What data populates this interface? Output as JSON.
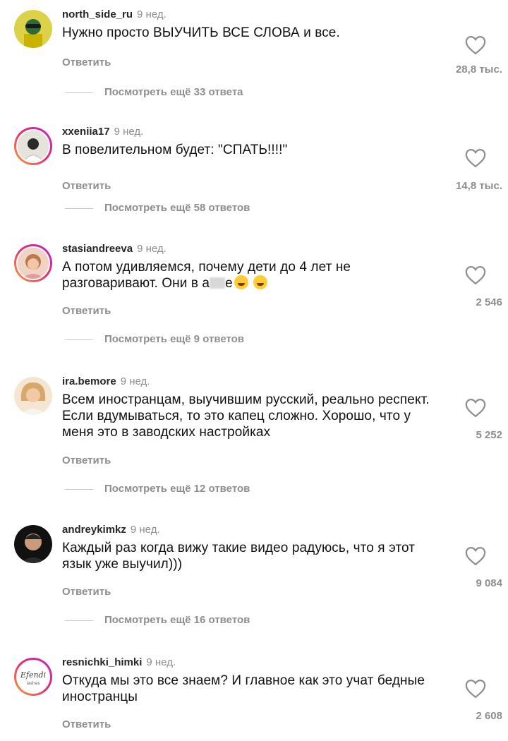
{
  "comments": [
    {
      "username": "north_side_ru",
      "time": "9 нед.",
      "text": "Нужно просто ВЫУЧИТЬ ВСЕ СЛОВА и все.",
      "reply_label": "Ответить",
      "likes": "28,8 тыс.",
      "view_more": "Посмотреть ещё 33 ответа"
    },
    {
      "username": "xxeniia17",
      "time": "9 нед.",
      "text": "В повелительном будет: \"СПАТЬ!!!!\"",
      "reply_label": "Ответить",
      "likes": "14,8 тыс.",
      "view_more": "Посмотреть ещё 58 ответов"
    },
    {
      "username": "stasiandreeva",
      "time": "9 нед.",
      "text_start": "А потом удивляемся, почему дети до 4 лет не разговаривают. Они в а",
      "text_end": "е",
      "reply_label": "Ответить",
      "likes": "2 546",
      "view_more": "Посмотреть ещё 9 ответов"
    },
    {
      "username": "ira.bemore",
      "time": "9 нед.",
      "text": "Всем иностранцам, выучившим русский, реально респект. Если вдумываться, то это капец сложно. Хорошо, что у меня это в заводских настройках",
      "reply_label": "Ответить",
      "likes": "5 252",
      "view_more": "Посмотреть ещё 12 ответов"
    },
    {
      "username": "andreykimkz",
      "time": "9 нед.",
      "text": "Каждый раз когда вижу такие видео радуюсь, что я этот язык уже выучил)))",
      "reply_label": "Ответить",
      "likes": "9 084",
      "view_more": "Посмотреть ещё 16 ответов"
    },
    {
      "username": "resnichki_himki",
      "time": "9 нед.",
      "text": "Откуда мы это все знаем? И главное как это учат бедные иностранцы",
      "reply_label": "Ответить",
      "likes": "2 608",
      "avatar_logo": "Efendi lashes"
    }
  ],
  "icons": {
    "like": "heart-outline-icon",
    "laugh": "rolling-on-floor-laughing-emoji"
  },
  "colors": {
    "secondary_text": "#8e8e8e",
    "story_ring": "#e52e71"
  }
}
